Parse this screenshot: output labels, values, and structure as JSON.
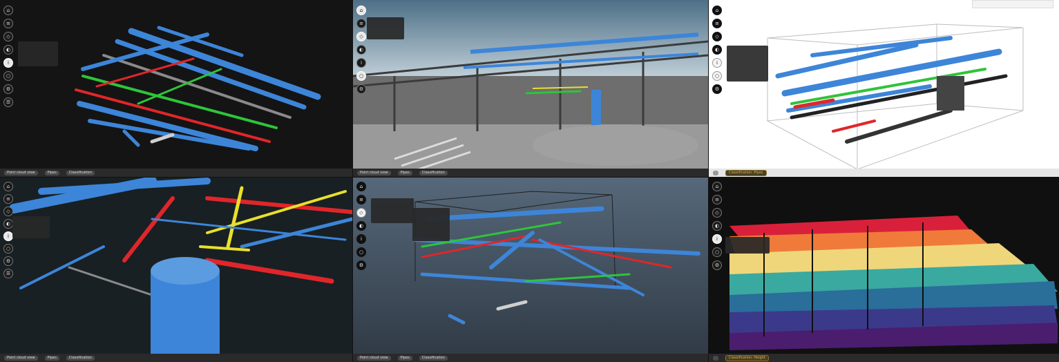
{
  "toolbar_icons": [
    "home-icon",
    "layers-icon",
    "measure-icon",
    "section-icon",
    "info-icon",
    "camera-icon",
    "settings-icon",
    "menu-icon"
  ],
  "panels": [
    {
      "status": {
        "left": "Point cloud view",
        "mid": "Pipes",
        "right": "Classification"
      }
    },
    {
      "status": {
        "left": "Point cloud view",
        "mid": "Pipes",
        "right": "Classification"
      }
    },
    {
      "status": {
        "left": "",
        "right": "Classification: Pipes"
      }
    },
    {
      "status": {
        "left": "Point cloud view",
        "mid": "Pipes",
        "right": "Classification"
      }
    },
    {
      "status": {
        "left": "Point cloud view",
        "mid": "Pipes",
        "right": "Classification"
      }
    },
    {
      "status": {
        "left": "",
        "right": "Classification: Height"
      }
    }
  ],
  "colors": {
    "pipe_blue": "#3d85d8",
    "pipe_green": "#2fc43a",
    "pipe_red": "#e0262a",
    "pipe_yellow": "#e9e02a",
    "steel": "#8a8a8a"
  }
}
